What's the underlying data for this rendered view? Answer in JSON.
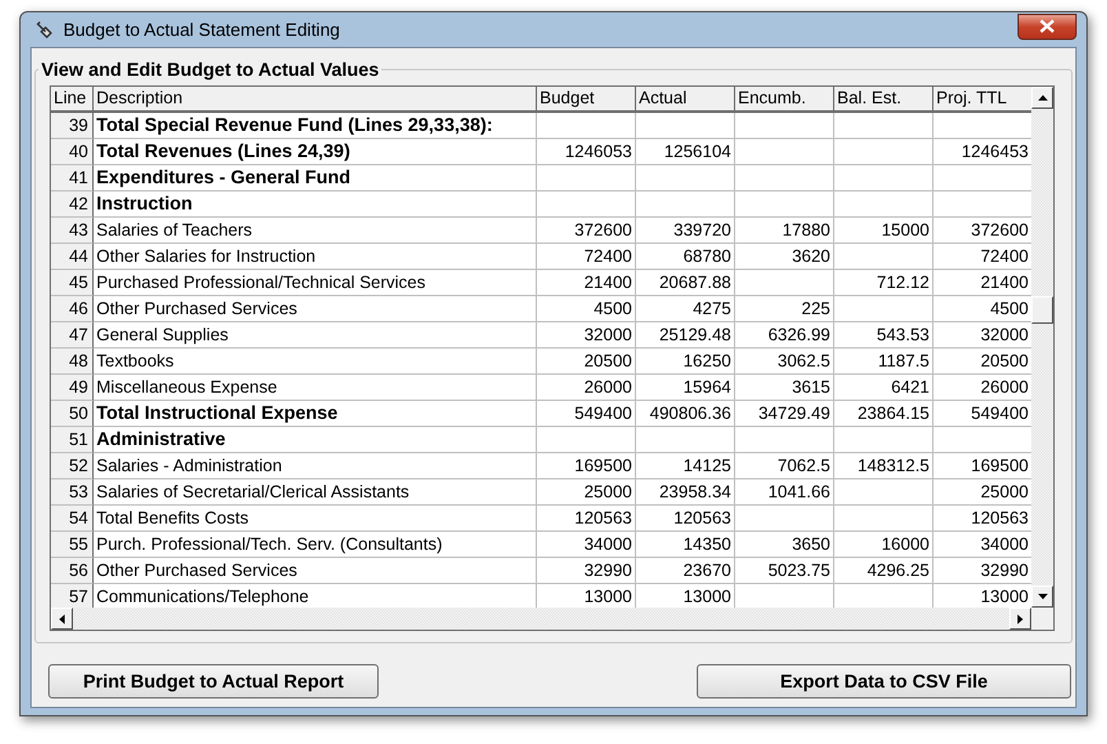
{
  "window": {
    "title": "Budget to Actual Statement Editing"
  },
  "group": {
    "title": "View and Edit Budget to Actual Values"
  },
  "table": {
    "columns": [
      "Line",
      "Description",
      "Budget",
      "Actual",
      "Encumb.",
      "Bal. Est.",
      "Proj. TTL"
    ],
    "rows": [
      {
        "line": "39",
        "description": "Total Special Revenue Fund (Lines 29,33,38):",
        "bold": true
      },
      {
        "line": "40",
        "description": "Total Revenues (Lines 24,39)",
        "bold": true,
        "budget": "1246053",
        "actual": "1256104",
        "proj_ttl": "1246453"
      },
      {
        "line": "41",
        "description": "Expenditures - General Fund",
        "bold": true
      },
      {
        "line": "42",
        "description": "Instruction",
        "bold": true
      },
      {
        "line": "43",
        "description": "Salaries of Teachers",
        "bold": false,
        "budget": "372600",
        "actual": "339720",
        "encumb": "17880",
        "bal_est": "15000",
        "proj_ttl": "372600"
      },
      {
        "line": "44",
        "description": "Other Salaries for Instruction",
        "bold": false,
        "budget": "72400",
        "actual": "68780",
        "encumb": "3620",
        "proj_ttl": "72400"
      },
      {
        "line": "45",
        "description": "Purchased Professional/Technical Services",
        "bold": false,
        "budget": "21400",
        "actual": "20687.88",
        "bal_est": "712.12",
        "proj_ttl": "21400"
      },
      {
        "line": "46",
        "description": "Other Purchased Services",
        "bold": false,
        "budget": "4500",
        "actual": "4275",
        "encumb": "225",
        "proj_ttl": "4500"
      },
      {
        "line": "47",
        "description": "General Supplies",
        "bold": false,
        "budget": "32000",
        "actual": "25129.48",
        "encumb": "6326.99",
        "bal_est": "543.53",
        "proj_ttl": "32000"
      },
      {
        "line": "48",
        "description": "Textbooks",
        "bold": false,
        "budget": "20500",
        "actual": "16250",
        "encumb": "3062.5",
        "bal_est": "1187.5",
        "proj_ttl": "20500"
      },
      {
        "line": "49",
        "description": "Miscellaneous Expense",
        "bold": false,
        "budget": "26000",
        "actual": "15964",
        "encumb": "3615",
        "bal_est": "6421",
        "proj_ttl": "26000"
      },
      {
        "line": "50",
        "description": "Total Instructional Expense",
        "bold": true,
        "budget": "549400",
        "actual": "490806.36",
        "encumb": "34729.49",
        "bal_est": "23864.15",
        "proj_ttl": "549400"
      },
      {
        "line": "51",
        "description": "Administrative",
        "bold": true
      },
      {
        "line": "52",
        "description": "Salaries - Administration",
        "bold": false,
        "budget": "169500",
        "actual": "14125",
        "encumb": "7062.5",
        "bal_est": "148312.5",
        "proj_ttl": "169500"
      },
      {
        "line": "53",
        "description": "Salaries of Secretarial/Clerical Assistants",
        "bold": false,
        "budget": "25000",
        "actual": "23958.34",
        "encumb": "1041.66",
        "proj_ttl": "25000"
      },
      {
        "line": "54",
        "description": "Total Benefits Costs",
        "bold": false,
        "budget": "120563",
        "actual": "120563",
        "proj_ttl": "120563"
      },
      {
        "line": "55",
        "description": "Purch. Professional/Tech. Serv. (Consultants)",
        "bold": false,
        "budget": "34000",
        "actual": "14350",
        "encumb": "3650",
        "bal_est": "16000",
        "proj_ttl": "34000"
      },
      {
        "line": "56",
        "description": "Other Purchased Services",
        "bold": false,
        "budget": "32990",
        "actual": "23670",
        "encumb": "5023.75",
        "bal_est": "4296.25",
        "proj_ttl": "32990"
      },
      {
        "line": "57",
        "description": "Communications/Telephone",
        "bold": false,
        "budget": "13000",
        "actual": "13000",
        "proj_ttl": "13000"
      }
    ]
  },
  "buttons": [
    "Print Budget to Actual Report",
    "Export Data to CSV File"
  ]
}
